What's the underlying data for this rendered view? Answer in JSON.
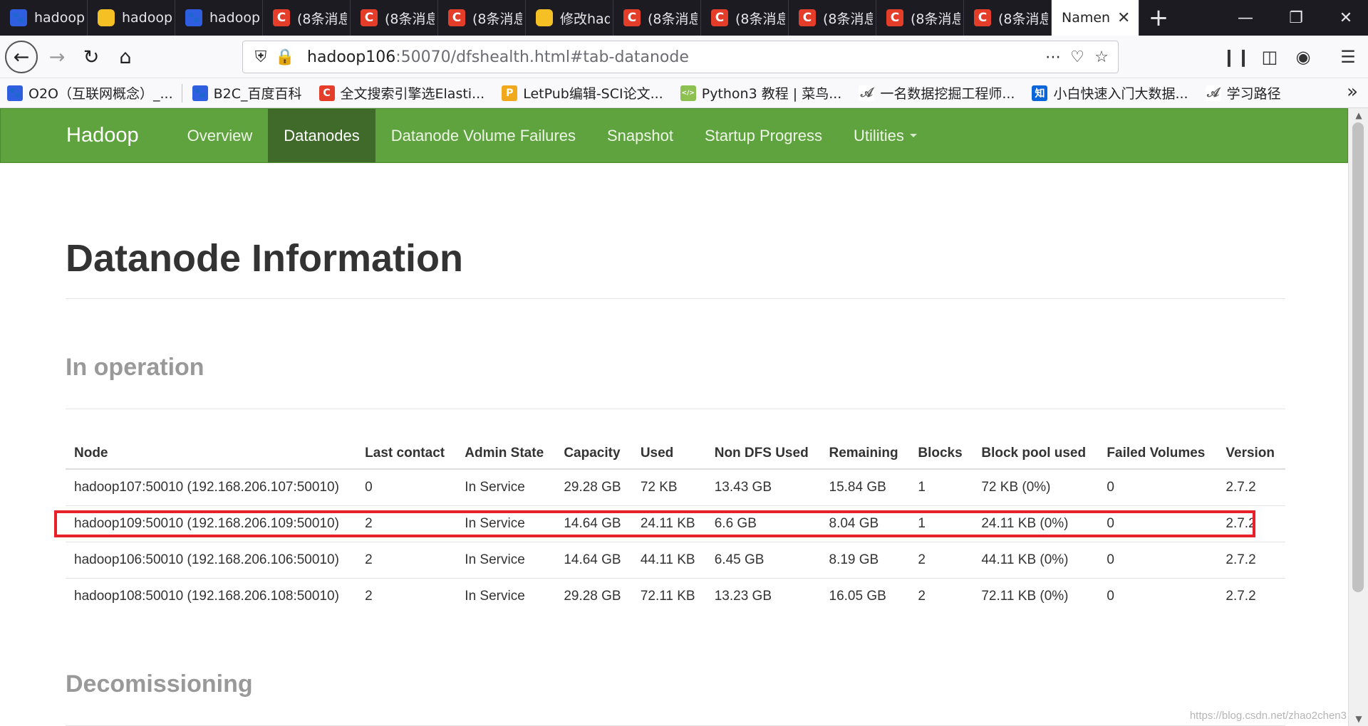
{
  "browser": {
    "tabs": [
      {
        "title": "hadoop",
        "favicon": "baidu-paw-icon",
        "kind": "baidu"
      },
      {
        "title": "hadoop",
        "favicon": "yellow-app-icon",
        "kind": "yellow"
      },
      {
        "title": "hadoop",
        "favicon": "baidu-paw-icon",
        "kind": "baidu"
      },
      {
        "title": "(8条消息",
        "favicon": "csdn-icon",
        "kind": "csdn"
      },
      {
        "title": "(8条消息",
        "favicon": "csdn-icon",
        "kind": "csdn"
      },
      {
        "title": "(8条消息",
        "favicon": "csdn-icon",
        "kind": "csdn"
      },
      {
        "title": "修改hadoop",
        "favicon": "yellow-app-icon",
        "kind": "yellow"
      },
      {
        "title": "(8条消息",
        "favicon": "csdn-icon",
        "kind": "csdn"
      },
      {
        "title": "(8条消息",
        "favicon": "csdn-icon",
        "kind": "csdn"
      },
      {
        "title": "(8条消息",
        "favicon": "csdn-icon",
        "kind": "csdn"
      },
      {
        "title": "(8条消息",
        "favicon": "csdn-icon",
        "kind": "csdn"
      },
      {
        "title": "(8条消息",
        "favicon": "csdn-icon",
        "kind": "csdn"
      }
    ],
    "active_tab_title": "Namenode information",
    "url_host": "hadoop106",
    "url_rest": ":50070/dfshealth.html#tab-datanode",
    "bookmarks": [
      {
        "label": "O2O（互联网概念）_...",
        "icon": "baidu-paw-icon",
        "color": "#2f5fe0",
        "glyph": "🐾"
      },
      {
        "label": "B2C_百度百科",
        "icon": "baidu-paw-icon",
        "color": "#2f5fe0",
        "glyph": "🐾"
      },
      {
        "label": "全文搜索引擎选Elasti...",
        "icon": "csdn-icon",
        "color": "#e43e2b",
        "glyph": "C"
      },
      {
        "label": "LetPub编辑-SCI论文...",
        "icon": "letpub-icon",
        "color": "#f0a81c",
        "glyph": "P"
      },
      {
        "label": "Python3 教程 | 菜鸟...",
        "icon": "runoob-icon",
        "color": "#8cc152",
        "glyph": "</>"
      },
      {
        "label": "一名数据挖掘工程师...",
        "icon": "feather-icon",
        "color": "#ffffff",
        "glyph": "𝒜"
      },
      {
        "label": "小白快速入门大数据...",
        "icon": "zhihu-icon",
        "color": "#0a66d8",
        "glyph": "知"
      },
      {
        "label": "学习路径",
        "icon": "feather-icon",
        "color": "#ffffff",
        "glyph": "𝒜"
      }
    ]
  },
  "hadoop": {
    "brand": "Hadoop",
    "nav": [
      "Overview",
      "Datanodes",
      "Datanode Volume Failures",
      "Snapshot",
      "Startup Progress",
      "Utilities"
    ],
    "active_nav": "Datanodes",
    "title": "Datanode Information",
    "section_in_operation": "In operation",
    "section_decom": "Decomissioning",
    "columns": [
      "Node",
      "Last contact",
      "Admin State",
      "Capacity",
      "Used",
      "Non DFS Used",
      "Remaining",
      "Blocks",
      "Block pool used",
      "Failed Volumes",
      "Version"
    ],
    "rows": [
      [
        "hadoop107:50010 (192.168.206.107:50010)",
        "0",
        "In Service",
        "29.28 GB",
        "72 KB",
        "13.43 GB",
        "15.84 GB",
        "1",
        "72 KB (0%)",
        "0",
        "2.7.2"
      ],
      [
        "hadoop109:50010 (192.168.206.109:50010)",
        "2",
        "In Service",
        "14.64 GB",
        "24.11 KB",
        "6.6 GB",
        "8.04 GB",
        "1",
        "24.11 KB (0%)",
        "0",
        "2.7.2"
      ],
      [
        "hadoop106:50010 (192.168.206.106:50010)",
        "2",
        "In Service",
        "14.64 GB",
        "44.11 KB",
        "6.45 GB",
        "8.19 GB",
        "2",
        "44.11 KB (0%)",
        "0",
        "2.7.2"
      ],
      [
        "hadoop108:50010 (192.168.206.108:50010)",
        "2",
        "In Service",
        "29.28 GB",
        "72.11 KB",
        "13.23 GB",
        "16.05 GB",
        "2",
        "72.11 KB (0%)",
        "0",
        "2.7.2"
      ]
    ],
    "highlighted_row": 1,
    "watermark": "https://blog.csdn.net/zhao2chen3"
  },
  "colors": {
    "hadoop_green": "#5fa33e",
    "hadoop_active": "#3f6a2a",
    "highlight": "#e8202a"
  }
}
